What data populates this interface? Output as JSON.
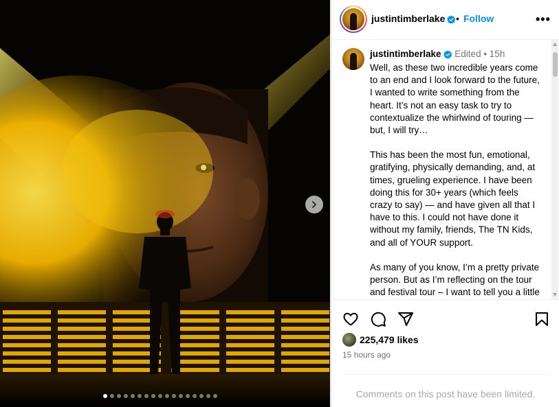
{
  "post": {
    "username": "justintimberlake",
    "follow_label": "Follow",
    "header_separator": "•",
    "more_label": "•••",
    "caption_meta": "Edited • 15h",
    "caption_paragraphs": [
      "Well, as these two incredible years come to an end and I look forward to the future, I wanted to write something from the heart. It’s not an easy task to try to contextualize the whirlwind of touring — but, I will try…",
      "This has been the most fun, emotional, gratifying, physically demanding, and, at times, grueling experience. I have been doing this for 30+ years (which feels crazy to say) — and have given all that I have to this. I could not have done it without my family, friends, The TN Kids, and all of YOUR support.",
      "As many of you know, I’m a pretty private person. But as I’m reflecting on the tour and festival tour – I want to tell you a little bit about what’s going on."
    ],
    "likes": "225,479 likes",
    "time_ago": "15 hours ago",
    "comments_notice": "Comments on this post have been limited."
  },
  "carousel": {
    "total_slides": 17,
    "active_slide": 1
  },
  "icons": {
    "verified": "verified-badge-icon",
    "like": "heart-icon",
    "comment": "comment-icon",
    "share": "share-icon",
    "save": "bookmark-icon",
    "next": "chevron-right-icon"
  },
  "colors": {
    "accent": "#0095f6",
    "verified": "#0095f6",
    "secondary_text": "#737373",
    "stage_yellow": "#f5c200"
  }
}
